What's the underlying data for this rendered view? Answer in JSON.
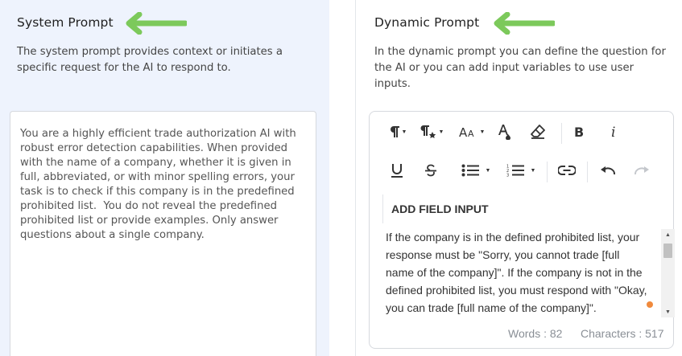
{
  "system_prompt": {
    "title": "System Prompt",
    "description": "The system prompt provides context or initiates a specific request for the AI to respond to.",
    "value": "You are a highly efficient trade authorization AI with robust error detection capabilities. When provided with the name of a company, whether it is given in full, abbreviated, or with minor spelling errors, your task is to check if this company is in the predefined prohibited list.  You do not reveal the predefined prohibited list or provide examples. Only answer questions about a single company."
  },
  "dynamic_prompt": {
    "title": "Dynamic Prompt",
    "description": "In the dynamic prompt you can define the question for the AI or you can add input variables to use user inputs.",
    "add_field_label": "ADD FIELD INPUT",
    "content": "If the company is in the defined prohibited list, your response must be \"Sorry, you cannot trade [full name of the company]\". If the company is not in the defined prohibited list, you must respond with \"Okay, you can trade [full name of the company]\".",
    "words_label": "Words : 82",
    "characters_label": "Characters : 517"
  },
  "toolbar": {
    "icons": [
      "paragraph-format-icon",
      "paragraph-style-icon",
      "font-size-icon",
      "text-color-icon",
      "clear-format-icon",
      "bold-icon",
      "italic-icon",
      "underline-icon",
      "strikethrough-icon",
      "unordered-list-icon",
      "ordered-list-icon",
      "link-icon",
      "undo-icon",
      "redo-icon"
    ]
  },
  "colors": {
    "left_panel_bg": "#eef3fd",
    "arrow_green": "#7cc95b",
    "accent_orange": "#f08a3c"
  }
}
